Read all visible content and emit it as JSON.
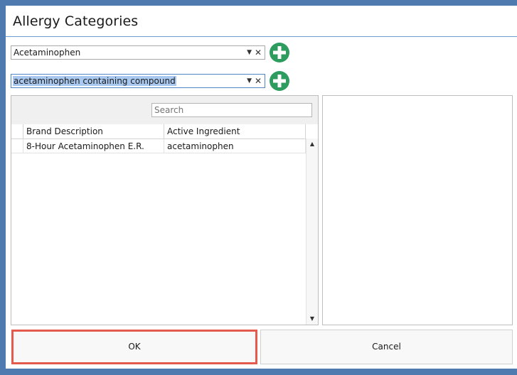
{
  "dialog": {
    "title": "Allergy Categories"
  },
  "category_combo": {
    "value": "Acetaminophen",
    "arrow_icon": "dropdown-arrow-icon",
    "clear_icon": "clear-x-icon",
    "clear_glyph": "✕",
    "arrow_glyph": "▼"
  },
  "compound_combo": {
    "value": "acetaminophen containing compound",
    "arrow_glyph": "▼",
    "clear_glyph": "✕"
  },
  "add_button": {
    "icon": "plus-circle-icon",
    "color": "#2e9b5f"
  },
  "grid": {
    "search_placeholder": "Search",
    "columns": [
      "Brand Description",
      "Active Ingredient"
    ],
    "rows": [
      [
        "8-Hour Acetaminophen E.R.",
        "acetaminophen"
      ]
    ],
    "scroll_up_glyph": "▲",
    "scroll_down_glyph": "▼"
  },
  "buttons": {
    "ok_label": "OK",
    "cancel_label": "Cancel"
  },
  "colors": {
    "background": "#4f7ab0",
    "accent_rule": "#6f9fd0",
    "highlight": "#e45b4d",
    "selection": "#a8c8ef"
  }
}
